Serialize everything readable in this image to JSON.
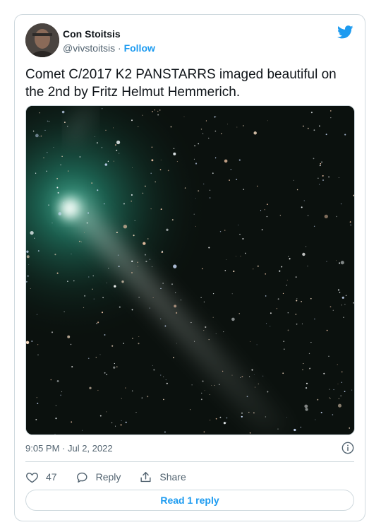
{
  "tweet": {
    "author_name": "Con Stoitsis",
    "author_handle": "@vivstoitsis",
    "separator": "·",
    "follow_label": "Follow",
    "text": "Comet C/2017 K2 PANSTARRS imaged beautiful on the 2nd by Fritz Helmut Hemmerich.",
    "timestamp": "9:05 PM · Jul 2, 2022",
    "like_count": "47",
    "reply_label": "Reply",
    "share_label": "Share",
    "read_replies_label": "Read 1 reply"
  },
  "icons": {
    "brand": "twitter-bird-icon",
    "info": "info-icon",
    "like": "heart-icon",
    "reply": "reply-bubble-icon",
    "share": "share-icon"
  },
  "colors": {
    "accent": "#1d9bf0",
    "secondary_text": "#536471",
    "border": "#cfd9de"
  }
}
